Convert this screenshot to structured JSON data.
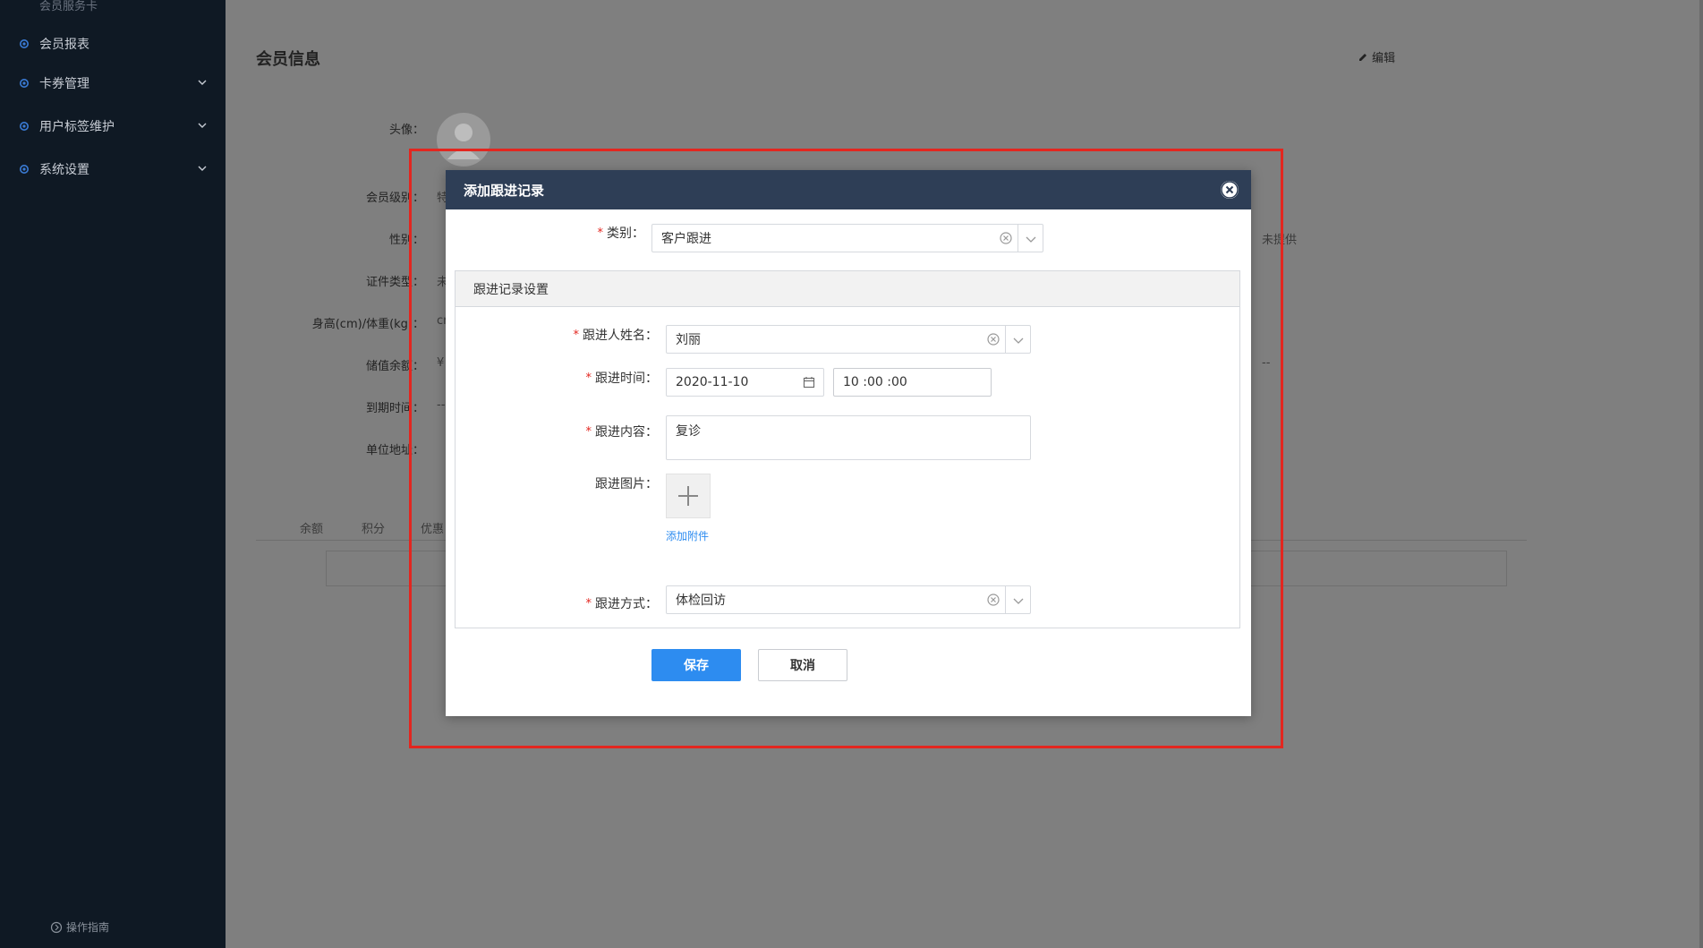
{
  "sidebar": {
    "top_cut_label": "会员服务卡",
    "items": [
      {
        "label": "会员报表",
        "icon": "gear-icon",
        "has_children": false
      },
      {
        "label": "卡券管理",
        "icon": "gear-icon",
        "has_children": true
      },
      {
        "label": "用户标签维护",
        "icon": "gear-icon",
        "has_children": true
      },
      {
        "label": "系统设置",
        "icon": "gear-icon",
        "has_children": true
      }
    ],
    "guide_label": "操作指南"
  },
  "content": {
    "title": "会员信息",
    "edit_label": "编辑",
    "fields": {
      "avatar_label": "头像：",
      "level_label": "会员级别：",
      "level_value": "特",
      "gender_label": "性别：",
      "id_type_label": "证件类型：",
      "id_type_value": "未",
      "height_weight_label": "身高(cm)/体重(kg)：",
      "height_weight_value": "cr",
      "balance_label": "储值余额：",
      "balance_value": "¥",
      "expire_label": "到期时间：",
      "expire_value": "--",
      "address_label": "单位地址：",
      "right_value_1": "未提供",
      "right_value_2": "--"
    },
    "tabs": [
      "余额",
      "积分",
      "优惠"
    ]
  },
  "modal": {
    "title": "添加跟进记录",
    "category_label": "类别：",
    "category_value": "客户跟进",
    "section_title": "跟进记录设置",
    "name_label": "跟进人姓名：",
    "name_value": "刘丽",
    "time_label": "跟进时间：",
    "date_value": "2020-11-10",
    "time_value": "10 :00 :00",
    "content_label": "跟进内容：",
    "content_value": "复诊",
    "image_label": "跟进图片：",
    "attach_link": "添加附件",
    "method_label": "跟进方式：",
    "method_value": "体检回访",
    "save_label": "保存",
    "cancel_label": "取消"
  },
  "colors": {
    "sidebar_bg": "#0f1924",
    "modal_header_bg": "#2e3e56",
    "primary": "#2d8cf0",
    "required": "#e3261f",
    "highlight": "#e3261f"
  }
}
